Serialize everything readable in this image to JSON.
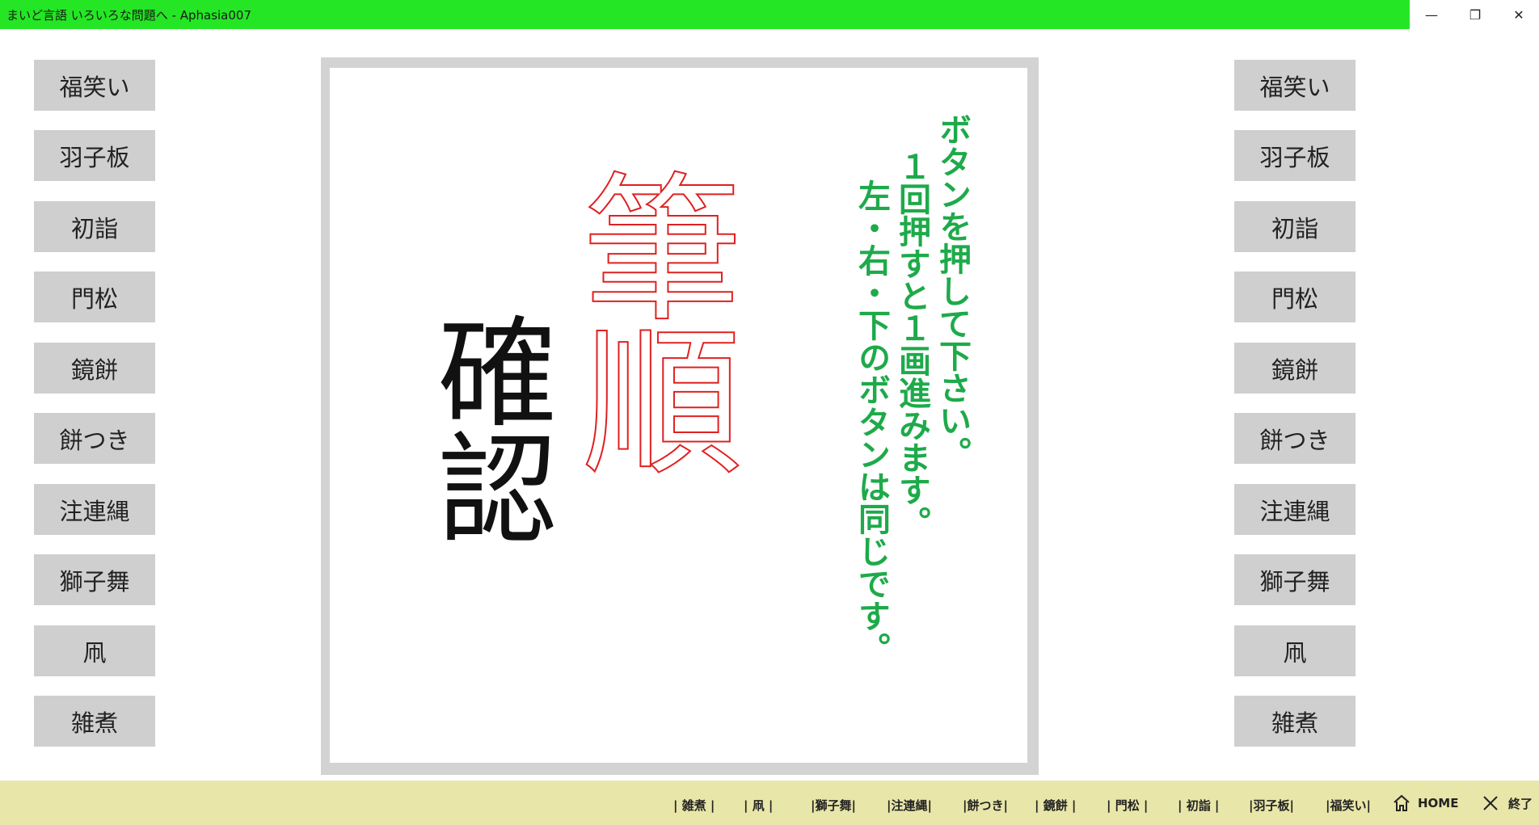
{
  "window": {
    "title": "まいど言語 いろいろな問題へ - Aphasia007",
    "minimize_glyph": "—",
    "restore_glyph": "❐",
    "close_glyph": "✕"
  },
  "left_buttons": [
    "福笑い",
    "羽子板",
    "初詣",
    "門松",
    "鏡餅",
    "餅つき",
    "注連縄",
    "獅子舞",
    "凧",
    "雑煮"
  ],
  "right_buttons": [
    "福笑い",
    "羽子板",
    "初詣",
    "門松",
    "鏡餅",
    "餅つき",
    "注連縄",
    "獅子舞",
    "凧",
    "雑煮"
  ],
  "board": {
    "red_text": "筆順",
    "black_text": "確認",
    "instructions": {
      "line1": "ボタンを押して下さい。",
      "line2": "１回押すと１画進みます。",
      "line3": "左・右・下のボタンは同じです。"
    }
  },
  "bottom_bar": {
    "items": [
      "| 雑煮 |",
      "| 凧 |",
      "|獅子舞|",
      "|注連縄|",
      "|餅つき|",
      "| 鏡餅 |",
      "| 門松 |",
      "| 初詣 |",
      "|羽子板|",
      "|福笑い|"
    ],
    "home_label": "HOME",
    "exit_label": "終了"
  },
  "colors": {
    "title_bar": "#24e624",
    "instruction_text": "#1eaa4a",
    "stroke_red": "#e02020",
    "bottom_bar": "#e8e6a8",
    "button_bg": "#cfcfcf"
  }
}
